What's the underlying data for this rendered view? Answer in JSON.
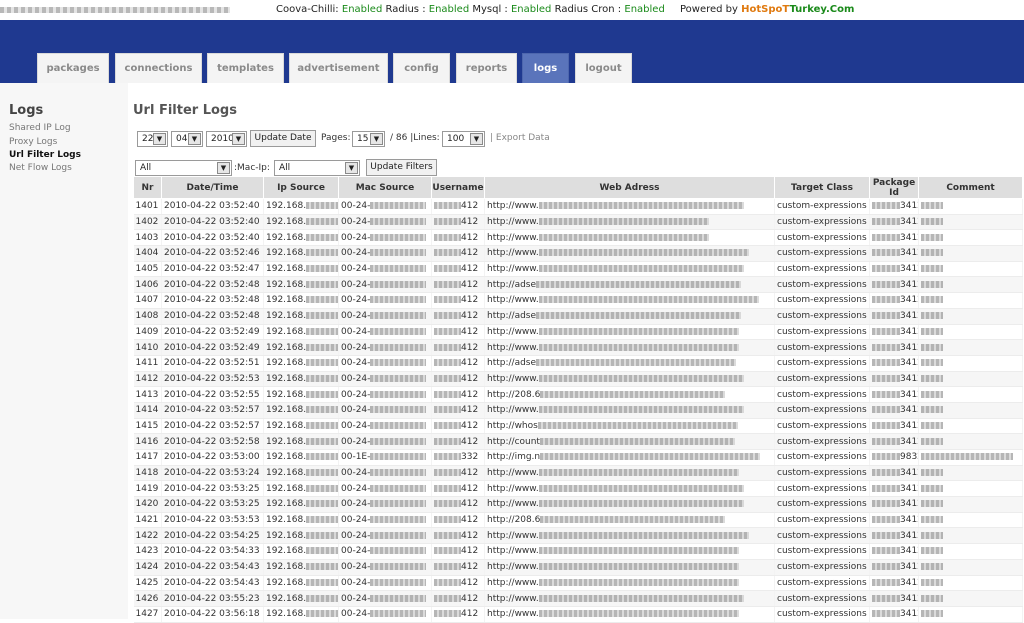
{
  "status": {
    "app": "Coova-Chilli:",
    "radius_label": "Radius :",
    "radius_value": "Enabled",
    "mysql_label": "Mysql :",
    "mysql_value": "Enabled",
    "cron_label": "Radius Cron :",
    "cron_value": "Enabled",
    "powered_label": "Powered by",
    "brand_part1": "HotSpoT",
    "brand_part2": "Turkey.Com"
  },
  "tabs": [
    "packages",
    "connections",
    "templates",
    "advertisement",
    "config",
    "reports",
    "logs",
    "logout"
  ],
  "active_tab": "logs",
  "sidebar": {
    "title": "Logs",
    "links": [
      "Shared IP Log",
      "Proxy Logs",
      "Url Filter Logs",
      "Net Flow Logs"
    ],
    "active": "Url Filter Logs"
  },
  "page_title": "Url Filter Logs",
  "filters": {
    "day": "22",
    "month": "04",
    "year": "2010",
    "update_date": "Update Date",
    "pages_label": "Pages:",
    "page": "15",
    "total_pages": "/ 86 |Lines:",
    "lines": "100",
    "export": "| Export Data",
    "filter1": "All",
    "mac_ip_label": ":Mac-Ip:",
    "filter2": "All",
    "update_filters": "Update Filters"
  },
  "table": {
    "headers": [
      "Nr",
      "Date/Time",
      "Ip Source",
      "Mac Source",
      "Username",
      "Web Adress",
      "Target Class",
      "Package Id",
      "Comment"
    ],
    "rows": [
      {
        "nr": "1401",
        "dt": "2010-04-22 03:52:40",
        "ip": "192.168.",
        "mac": "00-24-",
        "user": "412",
        "web": "http://www.",
        "cls": "custom-expressions",
        "pkg": "3412"
      },
      {
        "nr": "1402",
        "dt": "2010-04-22 03:52:40",
        "ip": "192.168.",
        "mac": "00-24-",
        "user": "412",
        "web": "http://www.",
        "cls": "custom-expressions",
        "pkg": "3412"
      },
      {
        "nr": "1403",
        "dt": "2010-04-22 03:52:40",
        "ip": "192.168.",
        "mac": "00-24-",
        "user": "412",
        "web": "http://www.",
        "cls": "custom-expressions",
        "pkg": "3412"
      },
      {
        "nr": "1404",
        "dt": "2010-04-22 03:52:46",
        "ip": "192.168.",
        "mac": "00-24-",
        "user": "412",
        "web": "http://www.",
        "cls": "custom-expressions",
        "pkg": "3412"
      },
      {
        "nr": "1405",
        "dt": "2010-04-22 03:52:47",
        "ip": "192.168.",
        "mac": "00-24-",
        "user": "412",
        "web": "http://www.",
        "cls": "custom-expressions",
        "pkg": "3412"
      },
      {
        "nr": "1406",
        "dt": "2010-04-22 03:52:48",
        "ip": "192.168.",
        "mac": "00-24-",
        "user": "412",
        "web": "http://adse",
        "cls": "custom-expressions",
        "pkg": "3412"
      },
      {
        "nr": "1407",
        "dt": "2010-04-22 03:52:48",
        "ip": "192.168.",
        "mac": "00-24-",
        "user": "412",
        "web": "http://www.",
        "cls": "custom-expressions",
        "pkg": "3412"
      },
      {
        "nr": "1408",
        "dt": "2010-04-22 03:52:48",
        "ip": "192.168.",
        "mac": "00-24-",
        "user": "412",
        "web": "http://adse",
        "cls": "custom-expressions",
        "pkg": "3412"
      },
      {
        "nr": "1409",
        "dt": "2010-04-22 03:52:49",
        "ip": "192.168.",
        "mac": "00-24-",
        "user": "412",
        "web": "http://www.",
        "cls": "custom-expressions",
        "pkg": "3412"
      },
      {
        "nr": "1410",
        "dt": "2010-04-22 03:52:49",
        "ip": "192.168.",
        "mac": "00-24-",
        "user": "412",
        "web": "http://www.",
        "cls": "custom-expressions",
        "pkg": "3412"
      },
      {
        "nr": "1411",
        "dt": "2010-04-22 03:52:51",
        "ip": "192.168.",
        "mac": "00-24-",
        "user": "412",
        "web": "http://adse",
        "cls": "custom-expressions",
        "pkg": "3412"
      },
      {
        "nr": "1412",
        "dt": "2010-04-22 03:52:53",
        "ip": "192.168.",
        "mac": "00-24-",
        "user": "412",
        "web": "http://www.",
        "cls": "custom-expressions",
        "pkg": "3412"
      },
      {
        "nr": "1413",
        "dt": "2010-04-22 03:52:55",
        "ip": "192.168.",
        "mac": "00-24-",
        "user": "412",
        "web": "http://208.6",
        "cls": "custom-expressions",
        "pkg": "3412"
      },
      {
        "nr": "1414",
        "dt": "2010-04-22 03:52:57",
        "ip": "192.168.",
        "mac": "00-24-",
        "user": "412",
        "web": "http://www.",
        "cls": "custom-expressions",
        "pkg": "3412"
      },
      {
        "nr": "1415",
        "dt": "2010-04-22 03:52:57",
        "ip": "192.168.",
        "mac": "00-24-",
        "user": "412",
        "web": "http://whos",
        "cls": "custom-expressions",
        "pkg": "3412"
      },
      {
        "nr": "1416",
        "dt": "2010-04-22 03:52:58",
        "ip": "192.168.",
        "mac": "00-24-",
        "user": "412",
        "web": "http://count",
        "cls": "custom-expressions",
        "pkg": "3412"
      },
      {
        "nr": "1417",
        "dt": "2010-04-22 03:53:00",
        "ip": "192.168.",
        "mac": "00-1E-",
        "user": "332",
        "web": "http://img.n",
        "cls": "custom-expressions",
        "pkg": "9832"
      },
      {
        "nr": "1418",
        "dt": "2010-04-22 03:53:24",
        "ip": "192.168.",
        "mac": "00-24-",
        "user": "412",
        "web": "http://www.",
        "cls": "custom-expressions",
        "pkg": "3412"
      },
      {
        "nr": "1419",
        "dt": "2010-04-22 03:53:25",
        "ip": "192.168.",
        "mac": "00-24-",
        "user": "412",
        "web": "http://www.",
        "cls": "custom-expressions",
        "pkg": "3412"
      },
      {
        "nr": "1420",
        "dt": "2010-04-22 03:53:25",
        "ip": "192.168.",
        "mac": "00-24-",
        "user": "412",
        "web": "http://www.",
        "cls": "custom-expressions",
        "pkg": "3412"
      },
      {
        "nr": "1421",
        "dt": "2010-04-22 03:53:53",
        "ip": "192.168.",
        "mac": "00-24-",
        "user": "412",
        "web": "http://208.6",
        "cls": "custom-expressions",
        "pkg": "3412"
      },
      {
        "nr": "1422",
        "dt": "2010-04-22 03:54:25",
        "ip": "192.168.",
        "mac": "00-24-",
        "user": "412",
        "web": "http://www.",
        "cls": "custom-expressions",
        "pkg": "3412"
      },
      {
        "nr": "1423",
        "dt": "2010-04-22 03:54:33",
        "ip": "192.168.",
        "mac": "00-24-",
        "user": "412",
        "web": "http://www.",
        "cls": "custom-expressions",
        "pkg": "3412"
      },
      {
        "nr": "1424",
        "dt": "2010-04-22 03:54:43",
        "ip": "192.168.",
        "mac": "00-24-",
        "user": "412",
        "web": "http://www.",
        "cls": "custom-expressions",
        "pkg": "3412"
      },
      {
        "nr": "1425",
        "dt": "2010-04-22 03:54:43",
        "ip": "192.168.",
        "mac": "00-24-",
        "user": "412",
        "web": "http://www.",
        "cls": "custom-expressions",
        "pkg": "3412"
      },
      {
        "nr": "1426",
        "dt": "2010-04-22 03:55:23",
        "ip": "192.168.",
        "mac": "00-24-",
        "user": "412",
        "web": "http://www.",
        "cls": "custom-expressions",
        "pkg": "3412"
      },
      {
        "nr": "1427",
        "dt": "2010-04-22 03:56:18",
        "ip": "192.168.",
        "mac": "00-24-",
        "user": "412",
        "web": "http://www.",
        "cls": "custom-expressions",
        "pkg": "3412"
      }
    ]
  }
}
